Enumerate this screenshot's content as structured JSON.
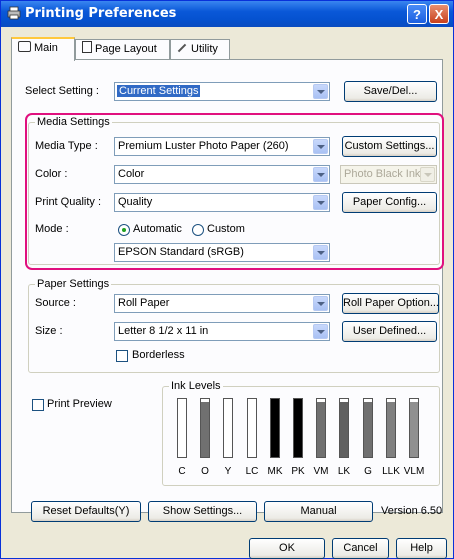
{
  "window": {
    "title": "Printing Preferences",
    "help_btn": "?",
    "close_btn": "X"
  },
  "tabs": [
    {
      "label": "Main",
      "icon": "printer-icon"
    },
    {
      "label": "Page Layout",
      "icon": "page-icon"
    },
    {
      "label": "Utility",
      "icon": "wrench-icon"
    }
  ],
  "select_setting": {
    "label": "Select Setting :",
    "value": "Current Settings",
    "save_button": "Save/Del..."
  },
  "media_settings": {
    "group_title": "Media Settings",
    "media_type": {
      "label": "Media Type :",
      "value": "Premium Luster Photo Paper (260)",
      "button": "Custom Settings..."
    },
    "color": {
      "label": "Color :",
      "value": "Color",
      "ink_value": "Photo Black Ink"
    },
    "print_quality": {
      "label": "Print Quality :",
      "value": "Quality",
      "button": "Paper Config..."
    },
    "mode": {
      "label": "Mode :",
      "automatic": "Automatic",
      "custom": "Custom",
      "selected": "Automatic",
      "value": "EPSON Standard (sRGB)"
    }
  },
  "paper_settings": {
    "group_title": "Paper Settings",
    "source": {
      "label": "Source :",
      "value": "Roll Paper",
      "button": "Roll Paper Option..."
    },
    "size": {
      "label": "Size :",
      "value": "Letter 8 1/2 x 11 in",
      "button": "User Defined..."
    },
    "borderless": {
      "label": "Borderless",
      "checked": false
    }
  },
  "print_preview": {
    "label": "Print Preview",
    "checked": false
  },
  "ink_levels": {
    "title": "Ink Levels",
    "inks": [
      {
        "name": "C",
        "level": 0.95,
        "color": "#ffffff"
      },
      {
        "name": "O",
        "level": 0.95,
        "color": "#707070"
      },
      {
        "name": "Y",
        "level": 0.95,
        "color": "#ffffff"
      },
      {
        "name": "LC",
        "level": 0.95,
        "color": "#ffffff"
      },
      {
        "name": "MK",
        "level": 1.0,
        "color": "#000000"
      },
      {
        "name": "PK",
        "level": 1.0,
        "color": "#000000"
      },
      {
        "name": "VM",
        "level": 0.95,
        "color": "#707070"
      },
      {
        "name": "LK",
        "level": 0.95,
        "color": "#606060"
      },
      {
        "name": "G",
        "level": 0.95,
        "color": "#707070"
      },
      {
        "name": "LLK",
        "level": 0.95,
        "color": "#808080"
      },
      {
        "name": "VLM",
        "level": 0.95,
        "color": "#909090"
      }
    ]
  },
  "bottom": {
    "reset_defaults": "Reset Defaults(Y)",
    "show_settings": "Show Settings...",
    "manual": "Manual",
    "version": "Version 6.50"
  },
  "footer": {
    "ok": "OK",
    "cancel": "Cancel",
    "help": "Help"
  },
  "colors": {
    "accent": "#e0107e",
    "titlebar": "#0a58d8"
  }
}
